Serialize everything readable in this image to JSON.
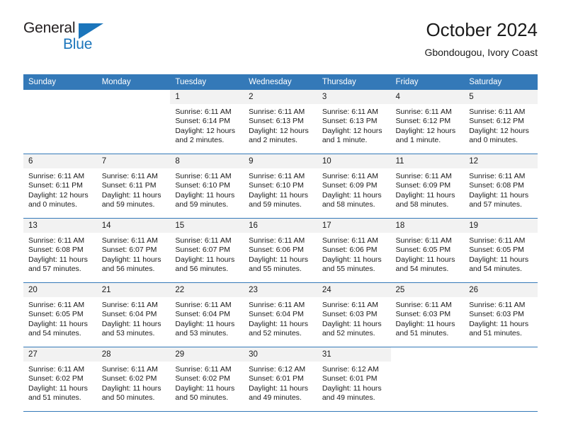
{
  "brand": {
    "name_top": "General",
    "name_bottom": "Blue",
    "accent_color": "#1b75bb",
    "logo_icon": "triangle-icon"
  },
  "header": {
    "title": "October 2024",
    "subtitle": "Gbondougou, Ivory Coast"
  },
  "theme": {
    "header_blue": "#3479b8",
    "daynum_gray": "#f2f2f2",
    "text": "#1a1a1a"
  },
  "labels": {
    "sunrise_prefix": "Sunrise:",
    "sunset_prefix": "Sunset:",
    "daylight_prefix": "Daylight:"
  },
  "weekdays": [
    "Sunday",
    "Monday",
    "Tuesday",
    "Wednesday",
    "Thursday",
    "Friday",
    "Saturday"
  ],
  "weeks": [
    [
      {
        "day": "",
        "sunrise": "",
        "sunset": "",
        "daylight_1": "",
        "daylight_2": ""
      },
      {
        "day": "",
        "sunrise": "",
        "sunset": "",
        "daylight_1": "",
        "daylight_2": ""
      },
      {
        "day": "1",
        "sunrise": "Sunrise: 6:11 AM",
        "sunset": "Sunset: 6:14 PM",
        "daylight_1": "Daylight: 12 hours",
        "daylight_2": "and 2 minutes."
      },
      {
        "day": "2",
        "sunrise": "Sunrise: 6:11 AM",
        "sunset": "Sunset: 6:13 PM",
        "daylight_1": "Daylight: 12 hours",
        "daylight_2": "and 2 minutes."
      },
      {
        "day": "3",
        "sunrise": "Sunrise: 6:11 AM",
        "sunset": "Sunset: 6:13 PM",
        "daylight_1": "Daylight: 12 hours",
        "daylight_2": "and 1 minute."
      },
      {
        "day": "4",
        "sunrise": "Sunrise: 6:11 AM",
        "sunset": "Sunset: 6:12 PM",
        "daylight_1": "Daylight: 12 hours",
        "daylight_2": "and 1 minute."
      },
      {
        "day": "5",
        "sunrise": "Sunrise: 6:11 AM",
        "sunset": "Sunset: 6:12 PM",
        "daylight_1": "Daylight: 12 hours",
        "daylight_2": "and 0 minutes."
      }
    ],
    [
      {
        "day": "6",
        "sunrise": "Sunrise: 6:11 AM",
        "sunset": "Sunset: 6:11 PM",
        "daylight_1": "Daylight: 12 hours",
        "daylight_2": "and 0 minutes."
      },
      {
        "day": "7",
        "sunrise": "Sunrise: 6:11 AM",
        "sunset": "Sunset: 6:11 PM",
        "daylight_1": "Daylight: 11 hours",
        "daylight_2": "and 59 minutes."
      },
      {
        "day": "8",
        "sunrise": "Sunrise: 6:11 AM",
        "sunset": "Sunset: 6:10 PM",
        "daylight_1": "Daylight: 11 hours",
        "daylight_2": "and 59 minutes."
      },
      {
        "day": "9",
        "sunrise": "Sunrise: 6:11 AM",
        "sunset": "Sunset: 6:10 PM",
        "daylight_1": "Daylight: 11 hours",
        "daylight_2": "and 59 minutes."
      },
      {
        "day": "10",
        "sunrise": "Sunrise: 6:11 AM",
        "sunset": "Sunset: 6:09 PM",
        "daylight_1": "Daylight: 11 hours",
        "daylight_2": "and 58 minutes."
      },
      {
        "day": "11",
        "sunrise": "Sunrise: 6:11 AM",
        "sunset": "Sunset: 6:09 PM",
        "daylight_1": "Daylight: 11 hours",
        "daylight_2": "and 58 minutes."
      },
      {
        "day": "12",
        "sunrise": "Sunrise: 6:11 AM",
        "sunset": "Sunset: 6:08 PM",
        "daylight_1": "Daylight: 11 hours",
        "daylight_2": "and 57 minutes."
      }
    ],
    [
      {
        "day": "13",
        "sunrise": "Sunrise: 6:11 AM",
        "sunset": "Sunset: 6:08 PM",
        "daylight_1": "Daylight: 11 hours",
        "daylight_2": "and 57 minutes."
      },
      {
        "day": "14",
        "sunrise": "Sunrise: 6:11 AM",
        "sunset": "Sunset: 6:07 PM",
        "daylight_1": "Daylight: 11 hours",
        "daylight_2": "and 56 minutes."
      },
      {
        "day": "15",
        "sunrise": "Sunrise: 6:11 AM",
        "sunset": "Sunset: 6:07 PM",
        "daylight_1": "Daylight: 11 hours",
        "daylight_2": "and 56 minutes."
      },
      {
        "day": "16",
        "sunrise": "Sunrise: 6:11 AM",
        "sunset": "Sunset: 6:06 PM",
        "daylight_1": "Daylight: 11 hours",
        "daylight_2": "and 55 minutes."
      },
      {
        "day": "17",
        "sunrise": "Sunrise: 6:11 AM",
        "sunset": "Sunset: 6:06 PM",
        "daylight_1": "Daylight: 11 hours",
        "daylight_2": "and 55 minutes."
      },
      {
        "day": "18",
        "sunrise": "Sunrise: 6:11 AM",
        "sunset": "Sunset: 6:05 PM",
        "daylight_1": "Daylight: 11 hours",
        "daylight_2": "and 54 minutes."
      },
      {
        "day": "19",
        "sunrise": "Sunrise: 6:11 AM",
        "sunset": "Sunset: 6:05 PM",
        "daylight_1": "Daylight: 11 hours",
        "daylight_2": "and 54 minutes."
      }
    ],
    [
      {
        "day": "20",
        "sunrise": "Sunrise: 6:11 AM",
        "sunset": "Sunset: 6:05 PM",
        "daylight_1": "Daylight: 11 hours",
        "daylight_2": "and 54 minutes."
      },
      {
        "day": "21",
        "sunrise": "Sunrise: 6:11 AM",
        "sunset": "Sunset: 6:04 PM",
        "daylight_1": "Daylight: 11 hours",
        "daylight_2": "and 53 minutes."
      },
      {
        "day": "22",
        "sunrise": "Sunrise: 6:11 AM",
        "sunset": "Sunset: 6:04 PM",
        "daylight_1": "Daylight: 11 hours",
        "daylight_2": "and 53 minutes."
      },
      {
        "day": "23",
        "sunrise": "Sunrise: 6:11 AM",
        "sunset": "Sunset: 6:04 PM",
        "daylight_1": "Daylight: 11 hours",
        "daylight_2": "and 52 minutes."
      },
      {
        "day": "24",
        "sunrise": "Sunrise: 6:11 AM",
        "sunset": "Sunset: 6:03 PM",
        "daylight_1": "Daylight: 11 hours",
        "daylight_2": "and 52 minutes."
      },
      {
        "day": "25",
        "sunrise": "Sunrise: 6:11 AM",
        "sunset": "Sunset: 6:03 PM",
        "daylight_1": "Daylight: 11 hours",
        "daylight_2": "and 51 minutes."
      },
      {
        "day": "26",
        "sunrise": "Sunrise: 6:11 AM",
        "sunset": "Sunset: 6:03 PM",
        "daylight_1": "Daylight: 11 hours",
        "daylight_2": "and 51 minutes."
      }
    ],
    [
      {
        "day": "27",
        "sunrise": "Sunrise: 6:11 AM",
        "sunset": "Sunset: 6:02 PM",
        "daylight_1": "Daylight: 11 hours",
        "daylight_2": "and 51 minutes."
      },
      {
        "day": "28",
        "sunrise": "Sunrise: 6:11 AM",
        "sunset": "Sunset: 6:02 PM",
        "daylight_1": "Daylight: 11 hours",
        "daylight_2": "and 50 minutes."
      },
      {
        "day": "29",
        "sunrise": "Sunrise: 6:11 AM",
        "sunset": "Sunset: 6:02 PM",
        "daylight_1": "Daylight: 11 hours",
        "daylight_2": "and 50 minutes."
      },
      {
        "day": "30",
        "sunrise": "Sunrise: 6:12 AM",
        "sunset": "Sunset: 6:01 PM",
        "daylight_1": "Daylight: 11 hours",
        "daylight_2": "and 49 minutes."
      },
      {
        "day": "31",
        "sunrise": "Sunrise: 6:12 AM",
        "sunset": "Sunset: 6:01 PM",
        "daylight_1": "Daylight: 11 hours",
        "daylight_2": "and 49 minutes."
      },
      {
        "day": "",
        "sunrise": "",
        "sunset": "",
        "daylight_1": "",
        "daylight_2": ""
      },
      {
        "day": "",
        "sunrise": "",
        "sunset": "",
        "daylight_1": "",
        "daylight_2": ""
      }
    ]
  ]
}
